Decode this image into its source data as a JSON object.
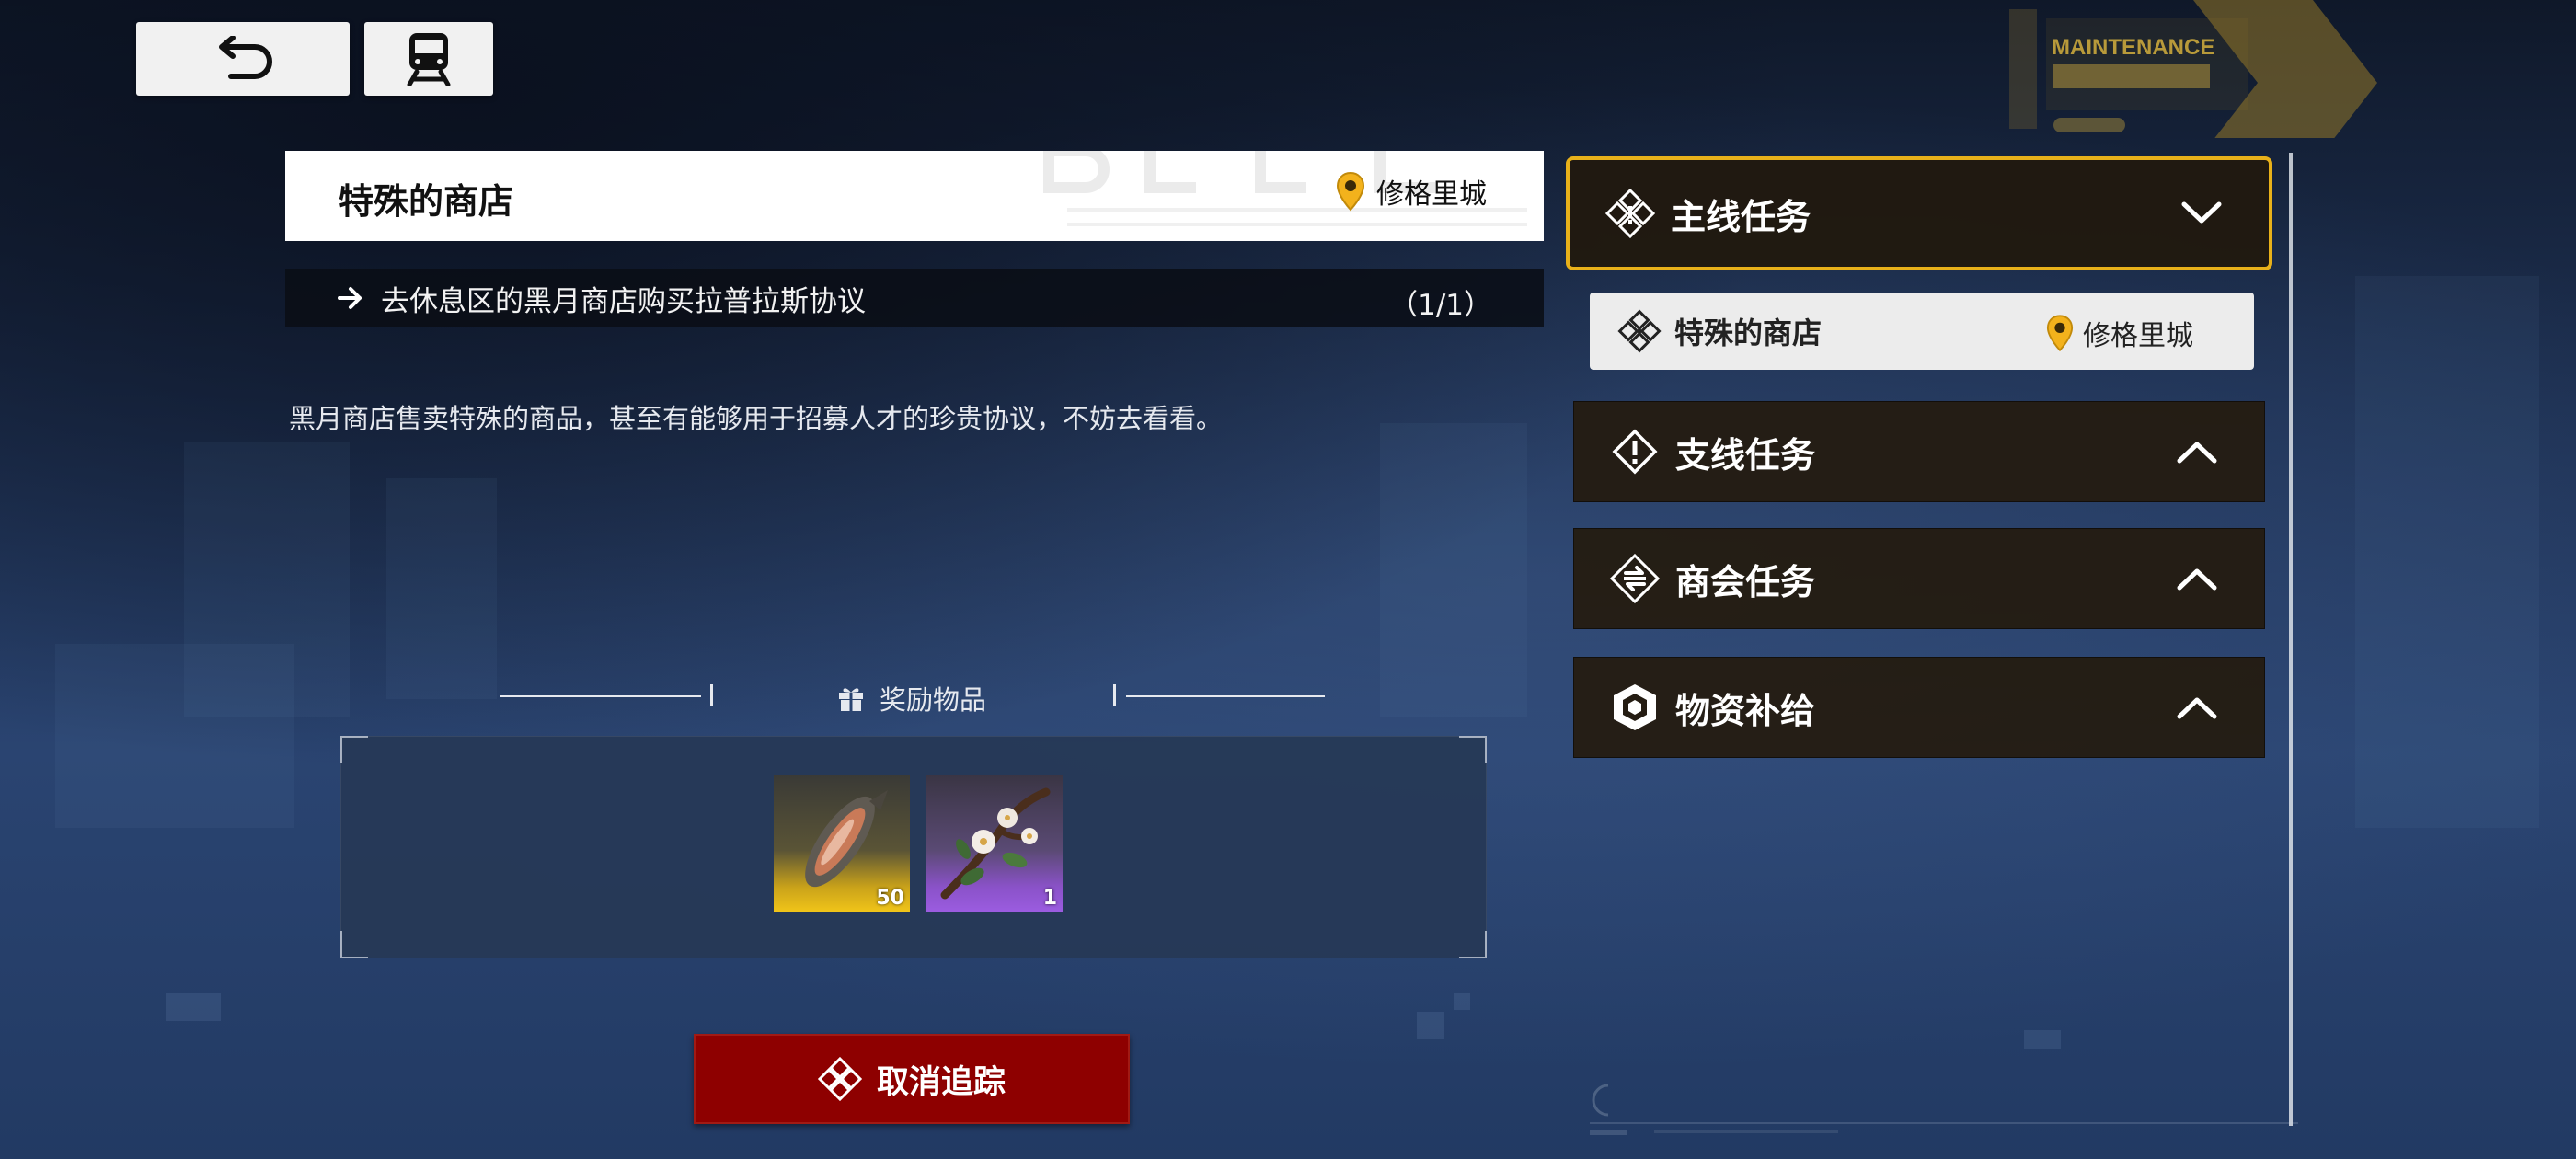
{
  "top_bar": {
    "back_icon": "back-arrow-icon",
    "train_icon": "train-icon"
  },
  "signage": {
    "maintenance": "MAINTENANCE"
  },
  "quest": {
    "title": "特殊的商店",
    "location": "修格里城",
    "objective": "去休息区的黑月商店购买拉普拉斯协议",
    "progress": "（1/1）",
    "description": "黑月商店售卖特殊的商品，甚至有能够用于招募人才的珍贵协议，不妨去看看。"
  },
  "rewards": {
    "label": "奖励物品",
    "items": [
      {
        "count": "50",
        "rarity_color": "#f0c419"
      },
      {
        "count": "1",
        "rarity_color": "#9b5ce0"
      }
    ]
  },
  "cancel_button": {
    "label": "取消追踪"
  },
  "categories": [
    {
      "label": "主线任务",
      "expanded": true
    },
    {
      "label": "支线任务",
      "expanded": false
    },
    {
      "label": "商会任务",
      "expanded": false
    },
    {
      "label": "物资补给",
      "expanded": false
    }
  ],
  "sub_quest": {
    "label": "特殊的商店",
    "location": "修格里城"
  },
  "colors": {
    "accent": "#e8b11a",
    "cancel": "#8e0000",
    "panel": "#241c12"
  }
}
